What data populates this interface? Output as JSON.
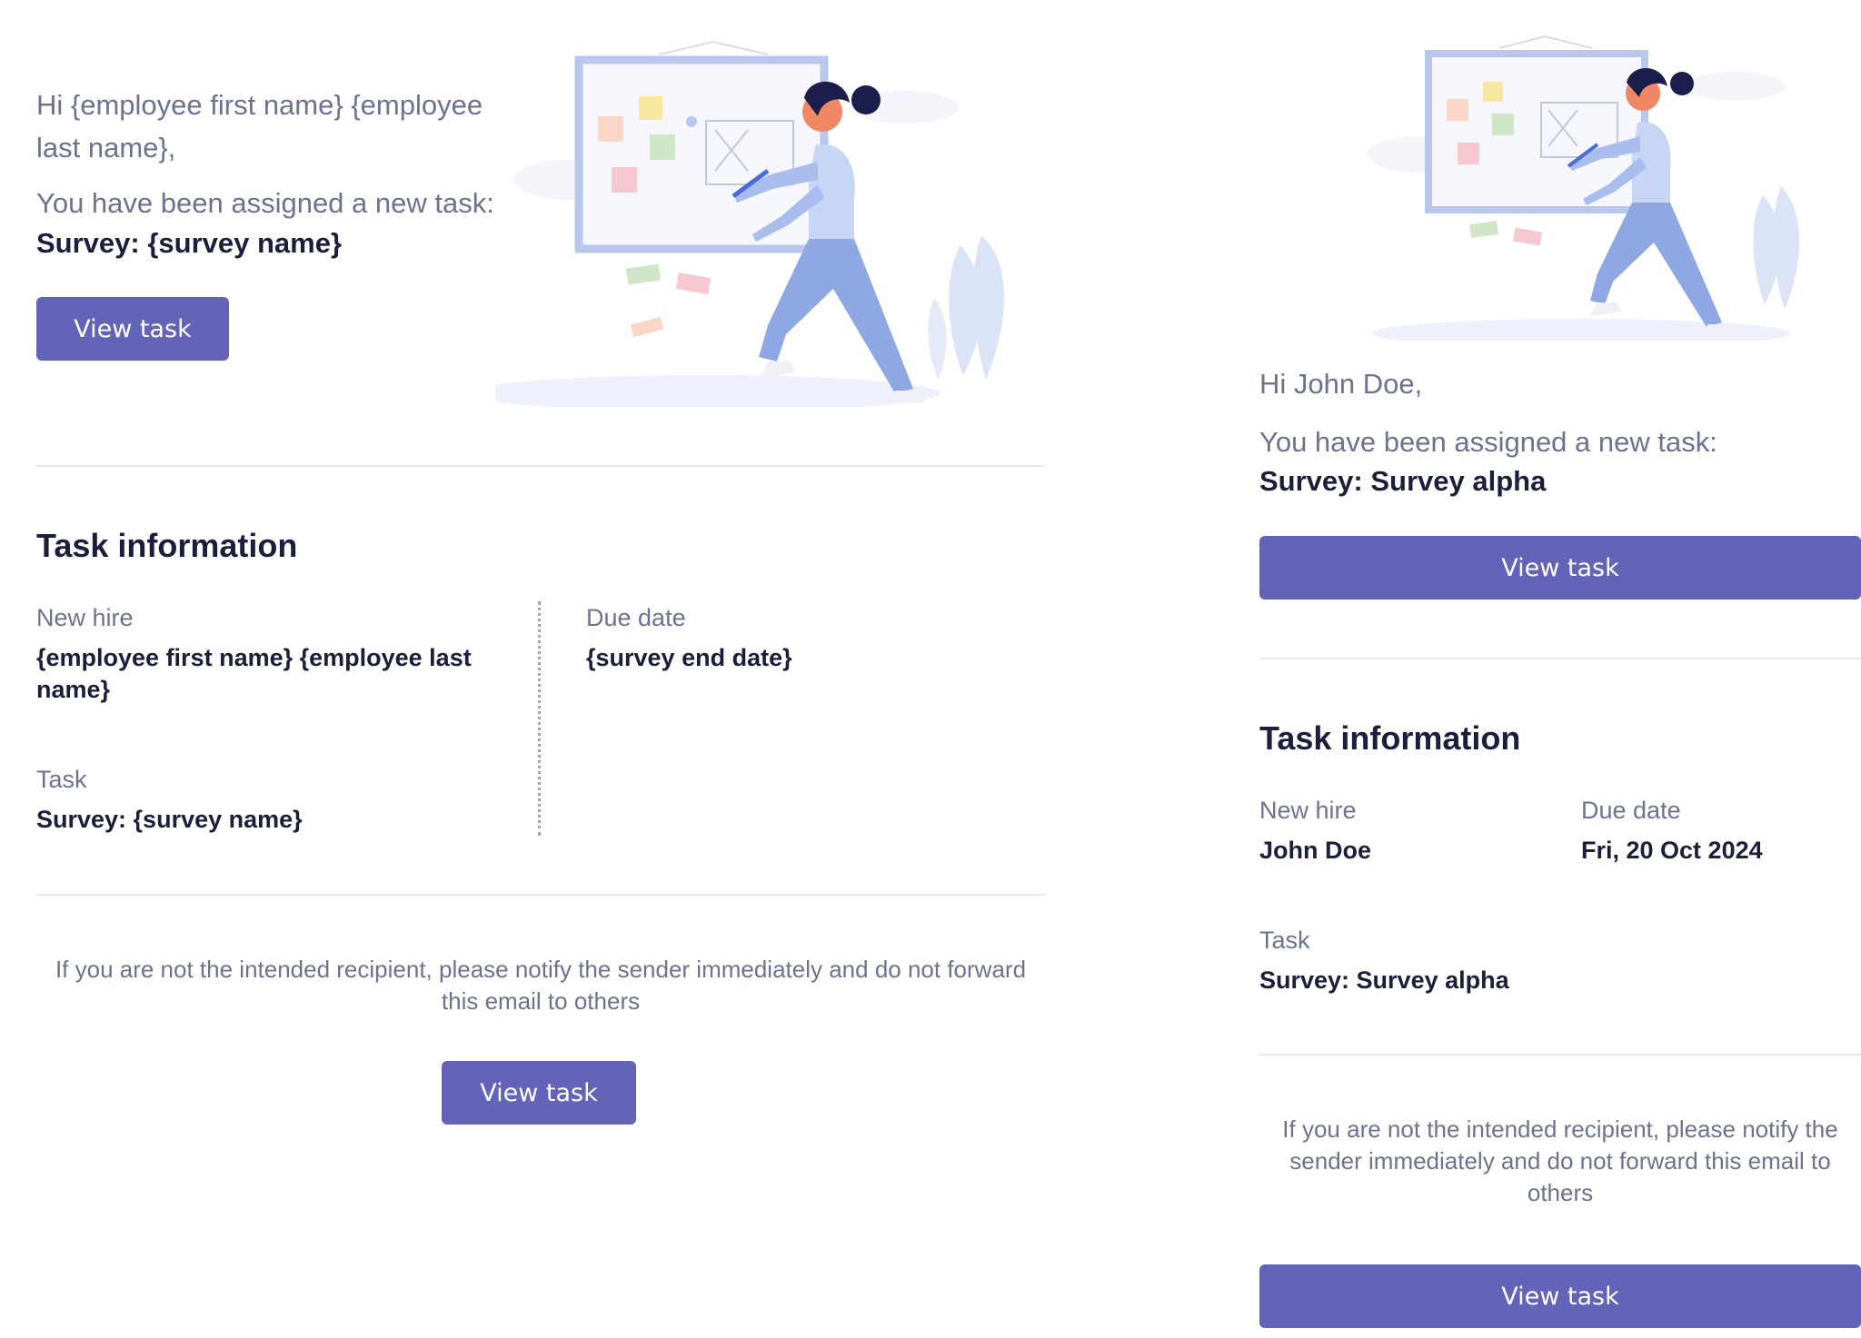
{
  "template": {
    "greeting": "Hi {employee first name} {employee last name},",
    "assigned_text": "You have been assigned a new task:",
    "survey_line": "Survey: {survey name}",
    "view_task_label": "View task",
    "section_title": "Task information",
    "new_hire_label": "New hire",
    "new_hire_value": "{employee first name} {employee last name}",
    "due_date_label": "Due date",
    "due_date_value": "{survey end date}",
    "task_label": "Task",
    "task_value": "Survey: {survey name}",
    "footer_note": "If you are not the intended recipient, please notify the sender immediately and do not forward this email to others",
    "footer_button_label": "View task"
  },
  "preview": {
    "greeting": "Hi John Doe,",
    "assigned_text": "You have been assigned a new task:",
    "survey_line": "Survey: Survey alpha",
    "view_task_label": "View task",
    "section_title": "Task information",
    "new_hire_label": "New hire",
    "new_hire_value": "John Doe",
    "due_date_label": "Due date",
    "due_date_value": "Fri, 20 Oct 2024",
    "task_label": "Task",
    "task_value": "Survey: Survey alpha",
    "footer_note": "If you are not the intended recipient, please notify the sender immediately and do not forward this email to others",
    "footer_button_label": "View task"
  },
  "colors": {
    "button": "#6363b8",
    "accent_red": "#e5545a",
    "muted_text": "#6b7390",
    "heading_text": "#1b1f3b"
  },
  "icons": {
    "hero": "whiteboard-person-illustration"
  }
}
